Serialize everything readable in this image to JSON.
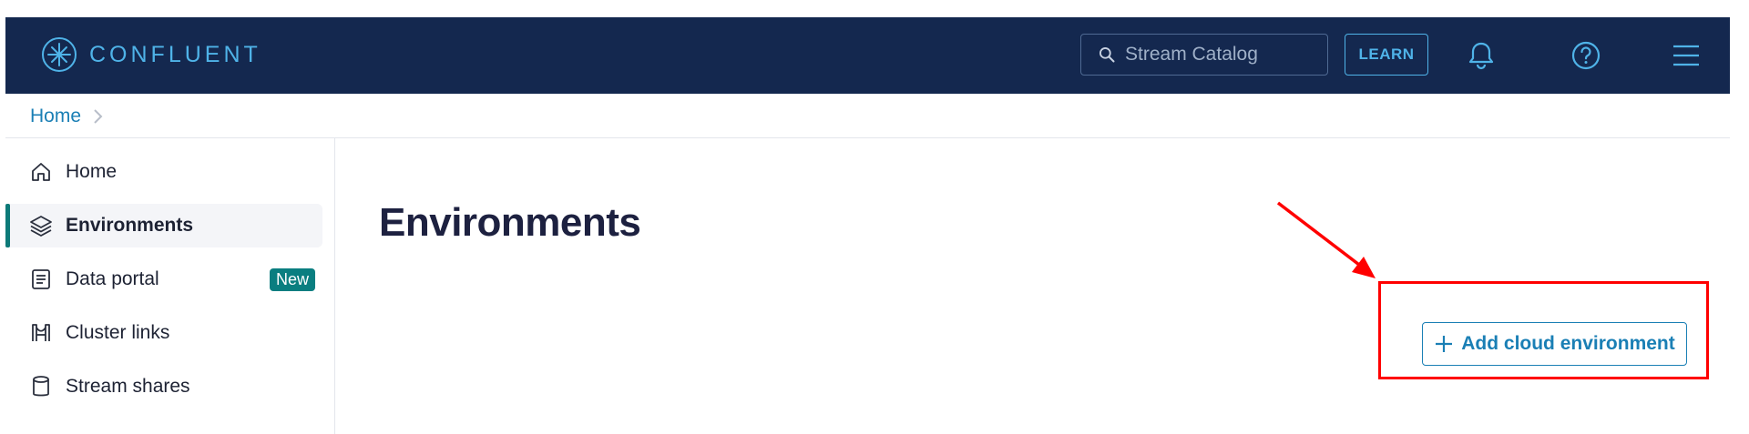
{
  "header": {
    "logo_text": "CONFLUENT",
    "search_placeholder": "Stream Catalog",
    "learn_label": "LEARN",
    "icons": [
      "bell-icon",
      "help-icon",
      "menu-icon"
    ]
  },
  "breadcrumb": {
    "items": [
      "Home"
    ]
  },
  "sidebar": {
    "items": [
      {
        "label": "Home",
        "icon": "home-icon"
      },
      {
        "label": "Environments",
        "icon": "layers-icon",
        "active": true
      },
      {
        "label": "Data portal",
        "icon": "document-icon",
        "badge": "New"
      },
      {
        "label": "Cluster links",
        "icon": "bridge-icon"
      },
      {
        "label": "Stream shares",
        "icon": "cylinder-icon"
      }
    ]
  },
  "main": {
    "title": "Environments",
    "add_button_label": "Add cloud environment"
  },
  "colors": {
    "topbar_bg": "#14284f",
    "accent": "#1a7fb5",
    "active_indicator": "#0d7a78",
    "annotation": "#ff0000"
  }
}
